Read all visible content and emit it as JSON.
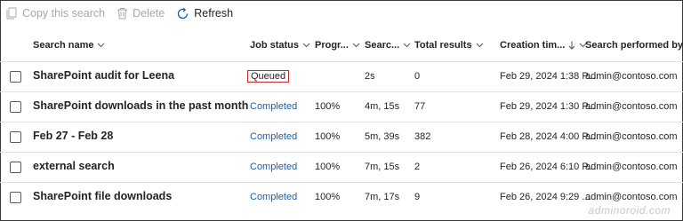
{
  "toolbar": {
    "copy_label": "Copy this search",
    "delete_label": "Delete",
    "refresh_label": "Refresh"
  },
  "columns": {
    "name": "Search name",
    "status": "Job status",
    "progress": "Progr...",
    "search_time": "Searc...",
    "total": "Total results",
    "created": "Creation tim...",
    "performed_by": "Search performed by"
  },
  "rows": [
    {
      "name": "SharePoint audit for Leena",
      "status": "Queued",
      "progress": "",
      "search_time": "2s",
      "total": "0",
      "created": "Feb 29, 2024 1:38 P...",
      "performed_by": "admin@contoso.com"
    },
    {
      "name": "SharePoint downloads in the past month",
      "status": "Completed",
      "progress": "100%",
      "search_time": "4m, 15s",
      "total": "77",
      "created": "Feb 29, 2024 1:30 P...",
      "performed_by": "admin@contoso.com"
    },
    {
      "name": "Feb 27 - Feb 28",
      "status": "Completed",
      "progress": "100%",
      "search_time": "5m, 39s",
      "total": "382",
      "created": "Feb 28, 2024 4:00 P...",
      "performed_by": "admin@contoso.com"
    },
    {
      "name": "external search",
      "status": "Completed",
      "progress": "100%",
      "search_time": "7m, 15s",
      "total": "2",
      "created": "Feb 26, 2024 6:10 P...",
      "performed_by": "admin@contoso.com"
    },
    {
      "name": "SharePoint file downloads",
      "status": "Completed",
      "progress": "100%",
      "search_time": "7m, 17s",
      "total": "9",
      "created": "Feb 26, 2024 9:29 ...",
      "performed_by": "admin@contoso.com"
    }
  ],
  "watermark": "adminoroid.com",
  "colors": {
    "link_blue": "#1f5ea8",
    "highlight_red": "#c62828",
    "disabled_gray": "#a8a8a8"
  }
}
